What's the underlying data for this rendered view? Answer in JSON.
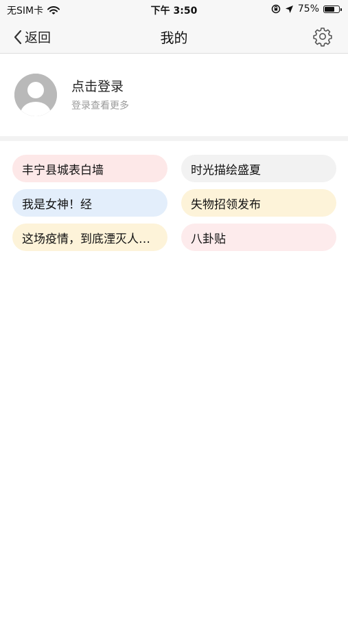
{
  "status_bar": {
    "carrier": "无SIM卡",
    "time": "下午 3:50",
    "battery_percent": "75%",
    "battery_level": 0.75
  },
  "nav": {
    "back_label": "返回",
    "title": "我的"
  },
  "profile": {
    "login_title": "点击登录",
    "login_subtitle": "登录查看更多"
  },
  "chips": [
    {
      "label": "丰宁县城表白墙",
      "color": "#fde8e8"
    },
    {
      "label": "时光描绘盛夏",
      "color": "#f2f2f2"
    },
    {
      "label": "我是女神！经",
      "color": "#e3eefb"
    },
    {
      "label": "失物招领发布",
      "color": "#fdf3d9"
    },
    {
      "label": "这场疫情，到底湮灭人性还是唤醒人性",
      "color": "#fdf3d9"
    },
    {
      "label": "八卦贴",
      "color": "#fdebec"
    }
  ]
}
